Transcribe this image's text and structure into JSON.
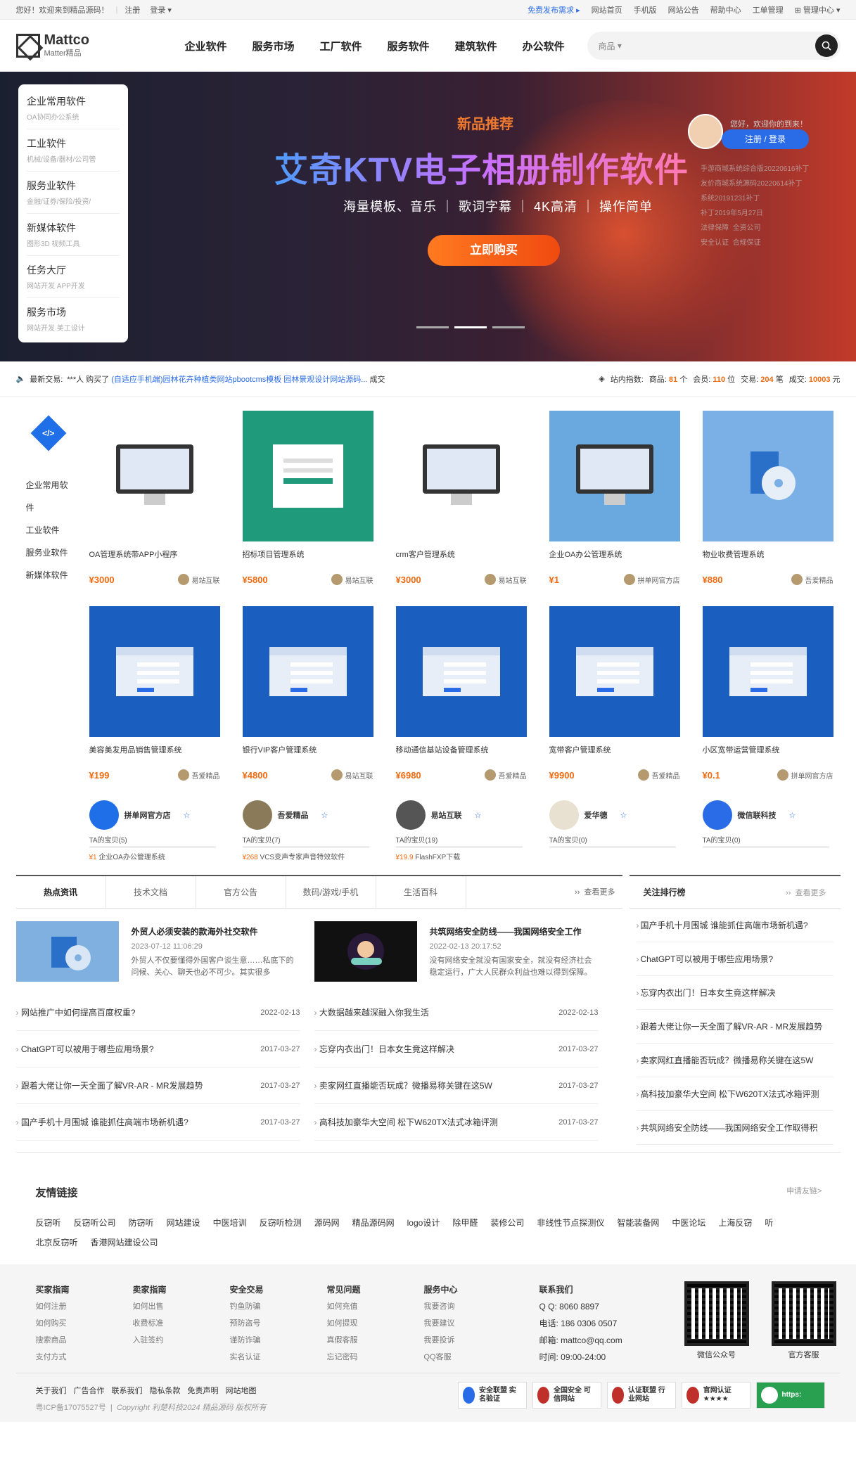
{
  "topbar": {
    "welcome": "您好！欢迎来到精品源码！",
    "register": "注册",
    "login": "登录",
    "free_publish": "免费发布需求",
    "links": [
      "网站首页",
      "手机版",
      "网站公告",
      "帮助中心",
      "工单管理",
      "管理中心"
    ]
  },
  "header": {
    "logo_main": "Mattco",
    "logo_sub": "Matter精品",
    "nav": [
      "企业软件",
      "服务市场",
      "工厂软件",
      "服务软件",
      "建筑软件",
      "办公软件"
    ],
    "search_placeholder": "商品"
  },
  "banner": {
    "categories": [
      {
        "title": "企业常用软件",
        "sub": "OA协同办公系统"
      },
      {
        "title": "工业软件",
        "sub": "机械/设备/器材/公司管"
      },
      {
        "title": "服务业软件",
        "sub": "金融/证券/保险/投资/"
      },
      {
        "title": "新媒体软件",
        "sub": "图形3D 视频工具"
      },
      {
        "title": "任务大厅",
        "sub": "网站开发 APP开发"
      },
      {
        "title": "服务市场",
        "sub": "网站开发 美工设计"
      }
    ],
    "tag": "新品推荐",
    "title": "艾奇KTV电子相册制作软件",
    "subtitle": "海量模板、音乐 ｜ 歌词字幕 ｜ 4K高清 ｜ 操作简单",
    "buy": "立即购买",
    "user_hi": "您好，欢迎你的到来！",
    "user_btn": "注册 / 登录",
    "user_news": [
      "手游商城系统综合版20220616补丁",
      "友价商城系统源码20220614补丁",
      "系统20191231补丁",
      "补丁2019年5月27日",
      "法律保障",
      "全资公司",
      "安全认证",
      "合规保证"
    ]
  },
  "ticker": {
    "label": "最新交易:",
    "text": "***人 购买了",
    "item": "(自适应手机端)园林花卉种植类网站pbootcms模板 园林景观设计网站源码...",
    "done": "成交",
    "index_label": "站内指数:",
    "goods_label": "商品:",
    "goods": "81",
    "goods_unit": "个",
    "members_label": "会员:",
    "members": "110",
    "members_unit": "位",
    "trades_label": "交易:",
    "trades": "204",
    "trades_unit": "笔",
    "volume_label": "成交:",
    "volume": "10003",
    "volume_unit": "元"
  },
  "sidecats": [
    "企业常用软",
    "件",
    "工业软件",
    "服务业软件",
    "新媒体软件"
  ],
  "products": [
    {
      "name": "OA管理系统带APP小程序",
      "price": "¥3000",
      "shop": "易站互联",
      "bg": "#ffffff"
    },
    {
      "name": "招标项目管理系统",
      "price": "¥5800",
      "shop": "易站互联",
      "bg": "#1f9a7a"
    },
    {
      "name": "crm客户管理系统",
      "price": "¥3000",
      "shop": "易站互联",
      "bg": "#ffffff"
    },
    {
      "name": "企业OA办公管理系统",
      "price": "¥1",
      "shop": "拼单网官方店",
      "bg": "#6aa8e0"
    },
    {
      "name": "物业收费管理系统",
      "price": "¥880",
      "shop": "吾爱精品",
      "bg": "#7ab0e6"
    },
    {
      "name": "美容美发用品销售管理系统",
      "price": "¥199",
      "shop": "吾爱精品",
      "bg": "#1a5fbf"
    },
    {
      "name": "银行VIP客户管理系统",
      "price": "¥4800",
      "shop": "易站互联",
      "bg": "#1a5fbf"
    },
    {
      "name": "移动通信基站设备管理系统",
      "price": "¥6980",
      "shop": "吾爱精品",
      "bg": "#1a5fbf"
    },
    {
      "name": "宽带客户管理系统",
      "price": "¥9900",
      "shop": "吾爱精品",
      "bg": "#1a5fbf"
    },
    {
      "name": "小区宽带运营管理系统",
      "price": "¥0.1",
      "shop": "拼单网官方店",
      "bg": "#1a5fbf"
    }
  ],
  "shops": [
    {
      "name": "拼单网官方店",
      "count": "TA的宝贝(5)",
      "item_price": "¥1",
      "item": "企业OA办公管理系统"
    },
    {
      "name": "吾爱精品",
      "count": "TA的宝贝(7)",
      "item_price": "¥268",
      "item": "VCS变声专家声音特效软件"
    },
    {
      "name": "易站互联",
      "count": "TA的宝贝(19)",
      "item_price": "¥19.9",
      "item": "FlashFXP下载"
    },
    {
      "name": "爱华德",
      "count": "TA的宝贝(0)",
      "item_price": "",
      "item": ""
    },
    {
      "name": "微信联科技",
      "count": "TA的宝贝(0)",
      "item_price": "",
      "item": ""
    }
  ],
  "news": {
    "tabs": [
      "热点资讯",
      "技术文档",
      "官方公告",
      "数码/游戏/手机",
      "生活百科"
    ],
    "more": "查看更多",
    "feat": [
      {
        "title": "外贸人必须安装的款海外社交软件",
        "date": "2023-07-12 11:06:29",
        "desc": "外贸人不仅要懂得外国客户谈生意……私底下的问候、关心、聊天也必不可少。其实很多"
      },
      {
        "title": "共筑网络安全防线——我国网络安全工作",
        "date": "2022-02-13 20:17:52",
        "desc": "没有网络安全就没有国家安全，就没有经济社会稳定运行，广大人民群众利益也难以得到保障。"
      }
    ],
    "left": [
      {
        "t": "网站推广中如何提高百度权重?",
        "d": "2022-02-13"
      },
      {
        "t": "ChatGPT可以被用于哪些应用场景?",
        "d": "2017-03-27"
      },
      {
        "t": "跟着大佬让你一天全面了解VR-AR - MR发展趋势",
        "d": "2017-03-27"
      },
      {
        "t": "国产手机十月围城 谁能抓住高端市场新机遇?",
        "d": "2017-03-27"
      }
    ],
    "right": [
      {
        "t": "大数据越来越深融入你我生活",
        "d": "2022-02-13"
      },
      {
        "t": "忘穿内衣出门！日本女生竟这样解决",
        "d": "2017-03-27"
      },
      {
        "t": "卖家网红直播能否玩成？微播易称关键在这5W",
        "d": "2017-03-27"
      },
      {
        "t": "高科技加豪华大空间 松下W620TX法式冰箱评测",
        "d": "2017-03-27"
      }
    ],
    "rank_title": "关注排行榜",
    "rank_more": "查看更多",
    "rank": [
      "国产手机十月围城 谁能抓住高端市场新机遇?",
      "ChatGPT可以被用于哪些应用场景?",
      "忘穿内衣出门！日本女生竟这样解决",
      "跟着大佬让你一天全面了解VR-AR - MR发展趋势",
      "卖家网红直播能否玩成？微播易称关键在这5W",
      "高科技加豪华大空间 松下W620TX法式冰箱评测",
      "共筑网络安全防线——我国网络安全工作取得积"
    ]
  },
  "links": {
    "title": "友情链接",
    "apply": "申请友链>",
    "items": [
      "反窃听",
      "反窃听公司",
      "防窃听",
      "网站建设",
      "中医培训",
      "反窃听检测",
      "源码网",
      "精品源码网",
      "logo设计",
      "除甲醛",
      "装修公司",
      "非线性节点探测仪",
      "智能装备网",
      "中医论坛",
      "上海反窃",
      "听",
      "北京反窃听",
      "香港网站建设公司"
    ]
  },
  "footer": {
    "cols": [
      {
        "h": "买家指南",
        "items": [
          "如何注册",
          "如何购买",
          "搜索商品",
          "支付方式"
        ]
      },
      {
        "h": "卖家指南",
        "items": [
          "如何出售",
          "收费标准",
          "入驻签约"
        ]
      },
      {
        "h": "安全交易",
        "items": [
          "钓鱼防骗",
          "预防盗号",
          "谨防诈骗",
          "实名认证"
        ]
      },
      {
        "h": "常见问题",
        "items": [
          "如何充值",
          "如何提现",
          "真假客服",
          "忘记密码"
        ]
      },
      {
        "h": "服务中心",
        "items": [
          "我要咨询",
          "我要建议",
          "我要投诉",
          "QQ客服"
        ]
      }
    ],
    "contact_title": "联系我们",
    "qq": "Q Q:  8060 8897",
    "phone": "电话:  186 0306 0507",
    "email": "邮箱:  mattco@qq.com",
    "time": "时间:  09:00-24:00",
    "qr1": "微信公众号",
    "qr2": "官方客服",
    "bottom_links": [
      "关于我们",
      "广告合作",
      "联系我们",
      "隐私条款",
      "免责声明",
      "网站地图"
    ],
    "icp": "粤ICP备17075527号",
    "copyright": "Copyright 利楚科技2024 精品源码 版权所有",
    "badges": [
      "安全联盟 实名验证",
      "全国安全 可信网站",
      "认证联盟 行业网站",
      "官网认证 ★★★★",
      "https:"
    ]
  }
}
